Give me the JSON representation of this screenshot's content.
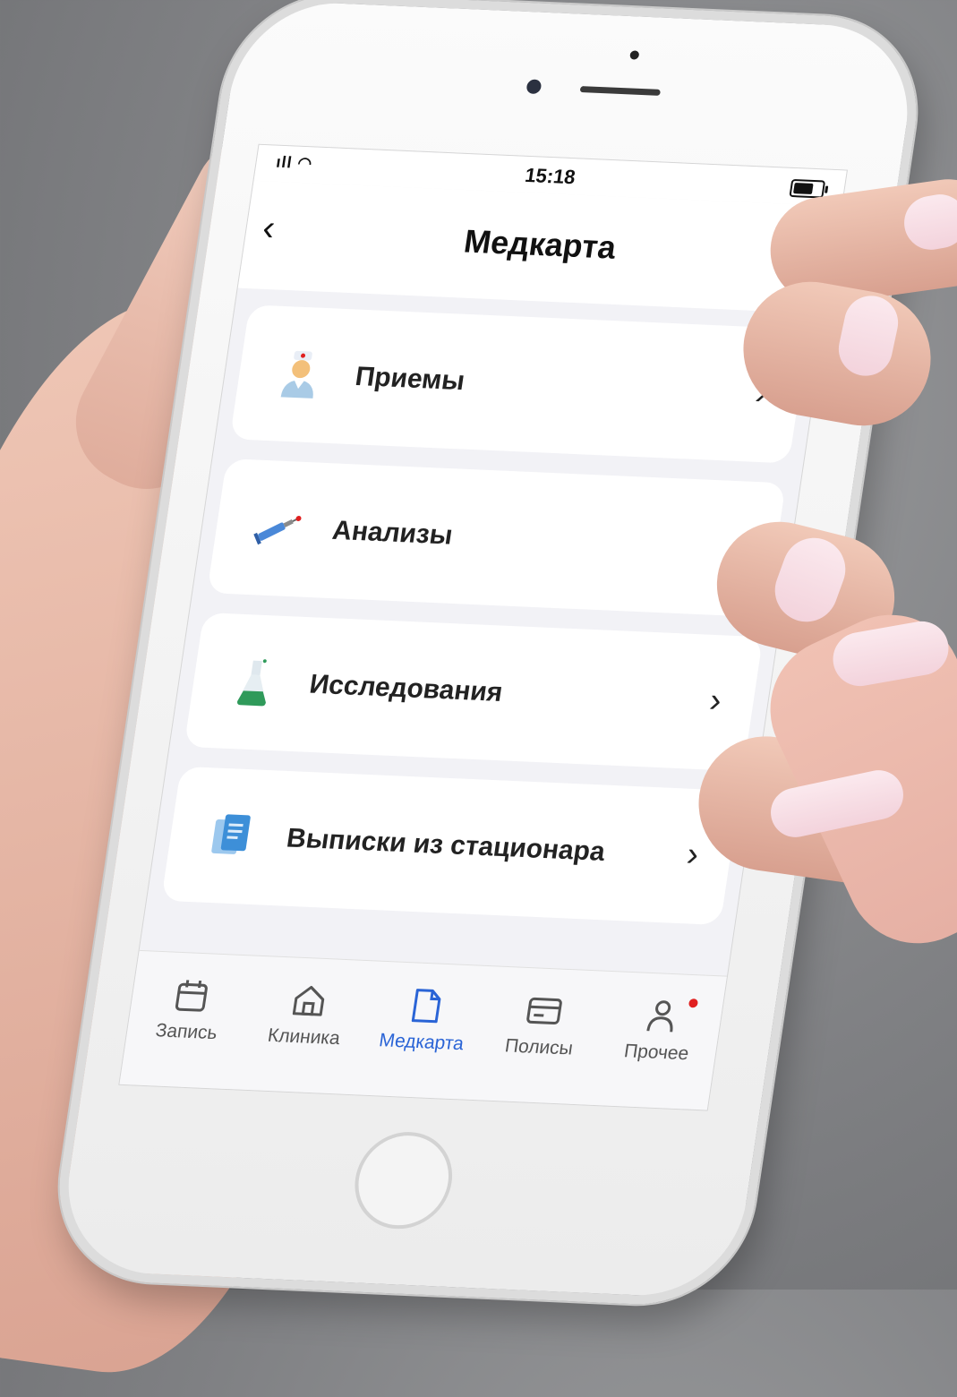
{
  "status_bar": {
    "signal": "ıll",
    "time": "15:18",
    "battery_level": 0.7
  },
  "nav": {
    "back_icon": "chevron-left-icon",
    "title": "Медкарта",
    "logout_icon": "logout-icon"
  },
  "menu_items": [
    {
      "label": "Приемы",
      "icon": "doctor-icon"
    },
    {
      "label": "Анализы",
      "icon": "syringe-icon"
    },
    {
      "label": "Исследования",
      "icon": "flask-icon"
    },
    {
      "label": "Выписки из стационара",
      "icon": "documents-icon"
    }
  ],
  "tabs": [
    {
      "label": "Запись",
      "icon": "calendar-icon",
      "active": false
    },
    {
      "label": "Клиника",
      "icon": "home-icon",
      "active": false
    },
    {
      "label": "Медкарта",
      "icon": "document-icon",
      "active": true
    },
    {
      "label": "Полисы",
      "icon": "card-icon",
      "active": false
    },
    {
      "label": "Прочее",
      "icon": "person-icon",
      "active": false,
      "badge": true
    }
  ],
  "colors": {
    "accent": "#2a64d6",
    "badge": "#e02020",
    "screen_bg": "#f2f2f6"
  }
}
